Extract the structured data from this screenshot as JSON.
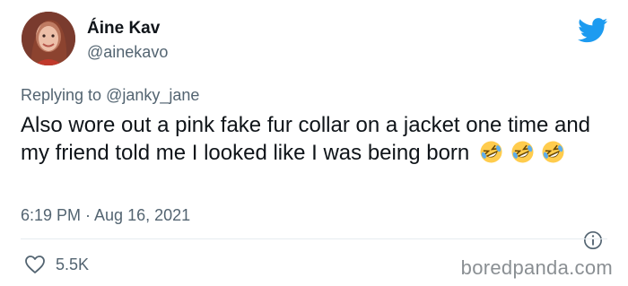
{
  "author": {
    "name": "Áine Kav",
    "handle": "@ainekavo"
  },
  "reply": {
    "prefix": "Replying to ",
    "to": "@janky_jane"
  },
  "tweet": {
    "text": "Also wore out a pink fake fur collar on a jacket one time and my friend told me I looked like I was being born",
    "emoji": [
      "rolling-on-floor-laughing",
      "rolling-on-floor-laughing",
      "rolling-on-floor-laughing"
    ],
    "timestamp": "6:19 PM · Aug 16, 2021"
  },
  "stats": {
    "likes": "5.5K"
  },
  "watermark": "boredpanda.com",
  "colors": {
    "twitter_blue": "#1d9bf0",
    "text_primary": "#0f1419",
    "text_secondary": "#536471",
    "divider": "#e6ecf0"
  },
  "icons": {
    "logo": "twitter-bird-icon",
    "info": "info-icon",
    "like": "heart-icon"
  }
}
